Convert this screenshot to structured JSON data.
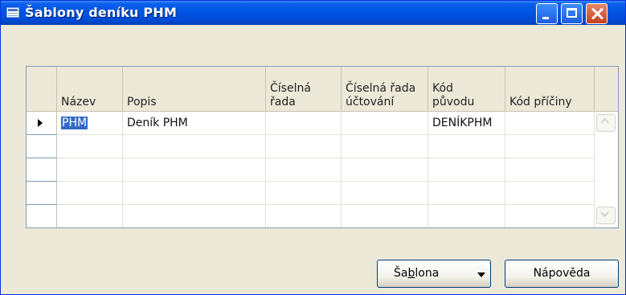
{
  "window": {
    "title": "Šablony deníku PHM"
  },
  "grid": {
    "columns": [
      {
        "id": "nazev",
        "label": "Název"
      },
      {
        "id": "popis",
        "label": "Popis"
      },
      {
        "id": "ciselna_rada",
        "label": "Číselná\nřada"
      },
      {
        "id": "ciselna_rada_uctovani",
        "label": "Číselná řada\núčtování"
      },
      {
        "id": "kod_puvodu",
        "label": "Kód\npůvodu"
      },
      {
        "id": "kod_priciny",
        "label": "Kód příčiny"
      }
    ],
    "rows": [
      {
        "nazev": "PHM",
        "popis": "Deník PHM",
        "ciselna_rada": "",
        "ciselna_rada_uctovani": "",
        "kod_puvodu": "DENÍKPHM",
        "kod_priciny": ""
      },
      {
        "nazev": "",
        "popis": "",
        "ciselna_rada": "",
        "ciselna_rada_uctovani": "",
        "kod_puvodu": "",
        "kod_priciny": ""
      },
      {
        "nazev": "",
        "popis": "",
        "ciselna_rada": "",
        "ciselna_rada_uctovani": "",
        "kod_puvodu": "",
        "kod_priciny": ""
      },
      {
        "nazev": "",
        "popis": "",
        "ciselna_rada": "",
        "ciselna_rada_uctovani": "",
        "kod_puvodu": "",
        "kod_priciny": ""
      },
      {
        "nazev": "",
        "popis": "",
        "ciselna_rada": "",
        "ciselna_rada_uctovani": "",
        "kod_puvodu": "",
        "kod_priciny": ""
      }
    ]
  },
  "buttons": {
    "sablona_pre": "Ša",
    "sablona_underline": "b",
    "sablona_post": "lona",
    "napoveda": "Nápověda"
  },
  "colors": {
    "title_bar": "#0054E3",
    "selection": "#316AC5",
    "dialog_bg": "#ECE9D8"
  }
}
